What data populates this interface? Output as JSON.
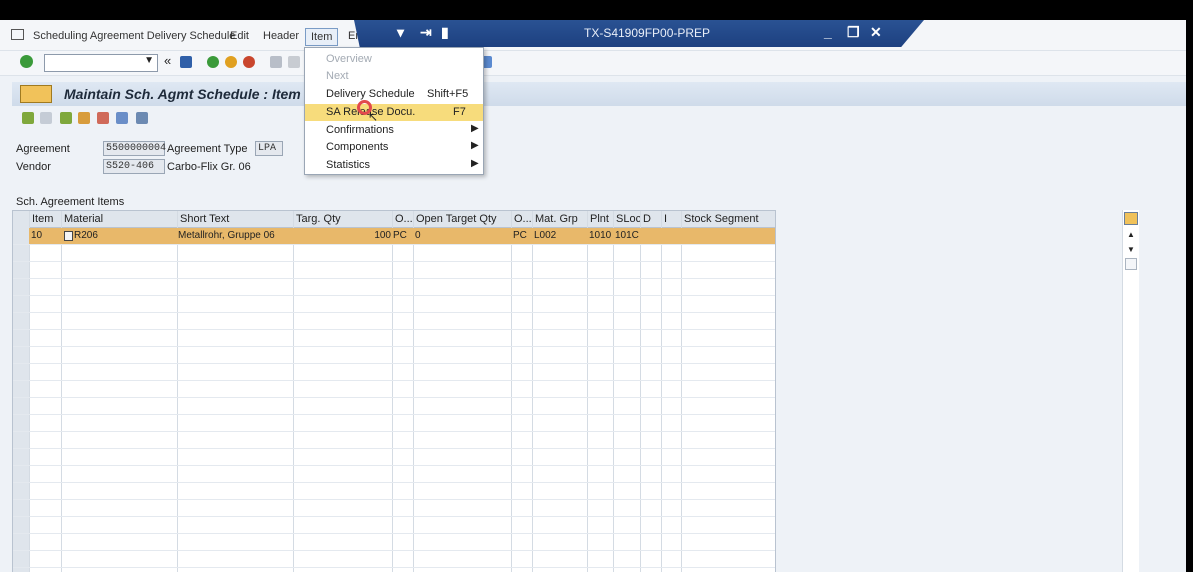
{
  "window": {
    "title": "TX-S41909FP00-PREP"
  },
  "menubar": {
    "transaction": "Scheduling Agreement Delivery Schedule",
    "edit": "Edit",
    "header": "Header",
    "item": "Item",
    "environment_partial": "Env"
  },
  "page": {
    "title": "Maintain Sch. Agmt Schedule : Item"
  },
  "fields": {
    "agreement_label": "Agreement",
    "agreement_value": "5500000004",
    "agreement_type_label": "Agreement Type",
    "agreement_type_value": "LPA",
    "vendor_label": "Vendor",
    "vendor_value": "S520-406",
    "vendor_name": "Carbo-Flix Gr. 06"
  },
  "section": {
    "title": "Sch. Agreement Items"
  },
  "grid": {
    "columns": [
      "Item",
      "Material",
      "Short Text",
      "Targ. Qty",
      "O...",
      "Open Target Qty",
      "O...",
      "Mat. Grp",
      "Plnt",
      "SLoc",
      "D",
      "I",
      "Stock Segment"
    ],
    "rows": [
      {
        "item": "10",
        "material": "R206",
        "short_text": "Metallrohr, Gruppe 06",
        "targ_qty": "100",
        "unit": "PC",
        "open_target_qty": "0",
        "unit2": "PC",
        "mat_grp": "L002",
        "plnt": "1010",
        "sloc": "101C",
        "d": "",
        "i": "",
        "stock_segment": ""
      }
    ]
  },
  "dropdown": {
    "items": [
      {
        "label": "Overview",
        "shortcut": "",
        "enabled": false,
        "submenu": false
      },
      {
        "label": "Next",
        "shortcut": "",
        "enabled": false,
        "submenu": false
      },
      {
        "label": "Delivery Schedule",
        "shortcut": "Shift+F5",
        "enabled": true,
        "submenu": false
      },
      {
        "label": "SA Release Docu.",
        "shortcut": "F7",
        "enabled": true,
        "submenu": false,
        "highlighted": true
      },
      {
        "label": "Confirmations",
        "shortcut": "",
        "enabled": true,
        "submenu": true
      },
      {
        "label": "Components",
        "shortcut": "",
        "enabled": true,
        "submenu": true
      },
      {
        "label": "Statistics",
        "shortcut": "",
        "enabled": true,
        "submenu": true
      }
    ]
  }
}
